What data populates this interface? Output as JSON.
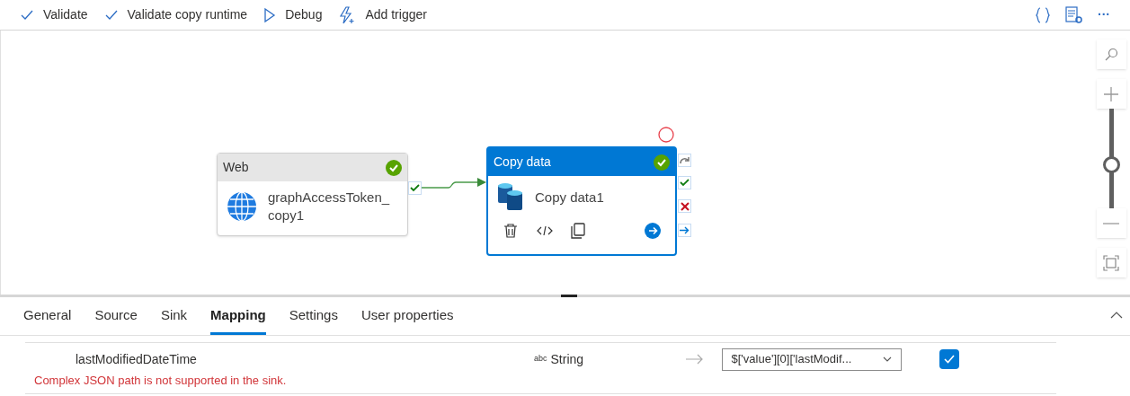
{
  "toolbar": {
    "buttons": [
      {
        "kind": "check",
        "label": "Validate"
      },
      {
        "kind": "check",
        "label": "Validate copy runtime"
      },
      {
        "kind": "play",
        "label": "Debug"
      },
      {
        "kind": "trigger",
        "label": "Add trigger"
      }
    ],
    "more": "···"
  },
  "canvas": {
    "nodes": [
      {
        "kind": "web",
        "type": "Web",
        "name": "graphAccessToken_\ncopy1",
        "selected": false,
        "valid": true
      },
      {
        "kind": "copy",
        "type": "Copy data",
        "name": "Copy data1",
        "selected": true,
        "valid": true
      }
    ],
    "zoom": {
      "level": 0.43
    }
  },
  "tabs": [
    {
      "label": "General",
      "selected": false
    },
    {
      "label": "Source",
      "selected": false
    },
    {
      "label": "Sink",
      "selected": false
    },
    {
      "label": "Mapping",
      "selected": true
    },
    {
      "label": "Settings",
      "selected": false
    },
    {
      "label": "User properties",
      "selected": false
    }
  ],
  "mapping": {
    "rows": [
      {
        "source": "lastModifiedDateTime",
        "type_badge": "abc",
        "type": "String",
        "sink": "$['value'][0]['lastModif...",
        "checked": true,
        "error": "Complex JSON path is not supported in the sink."
      }
    ]
  }
}
